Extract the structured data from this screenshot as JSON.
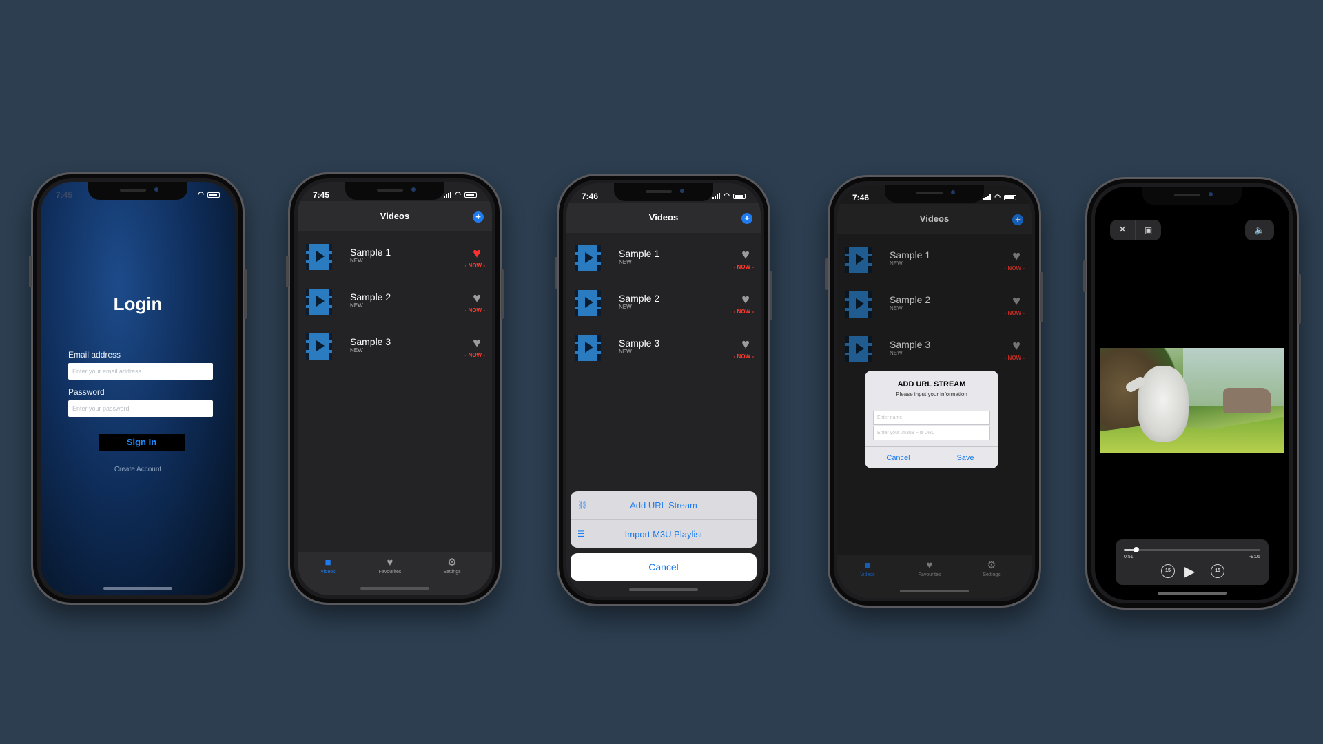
{
  "status": {
    "time_login": "7:45",
    "time_list": "7:45",
    "time_sheet": "7:46",
    "time_alert": "7:46"
  },
  "login": {
    "title": "Login",
    "email_label": "Email address",
    "email_placeholder": "Enter your email address",
    "password_label": "Password",
    "password_placeholder": "Enter your password",
    "signin_label": "Sign In",
    "create_account_label": "Create Account"
  },
  "videos": {
    "nav_title": "Videos",
    "add_icon": "plus-circle-icon",
    "items": [
      {
        "title": "Sample 1",
        "subtitle": "NEW",
        "badge": "- NOW -"
      },
      {
        "title": "Sample 2",
        "subtitle": "NEW",
        "badge": "- NOW -"
      },
      {
        "title": "Sample 3",
        "subtitle": "NEW",
        "badge": "- NOW -"
      }
    ],
    "favourite_colors": {
      "on": "#ff3030",
      "off": "#9b9b9b"
    }
  },
  "tabbar": {
    "videos": "Videos",
    "favourites": "Favourites",
    "settings": "Settings"
  },
  "action_sheet": {
    "add_url_stream": "Add URL Stream",
    "import_playlist": "Import M3U Playlist",
    "cancel": "Cancel"
  },
  "alert": {
    "title": "ADD URL STREAM",
    "message": "Please input your information",
    "name_placeholder": "Enter name",
    "url_placeholder": "Enter your .m3u8 File URL",
    "cancel": "Cancel",
    "save": "Save"
  },
  "player": {
    "elapsed": "0:51",
    "remaining": "-9:05",
    "progress_fraction": 0.09,
    "skip_back": "15",
    "skip_forward": "15"
  },
  "colors": {
    "background": "#2c3e50",
    "accent": "#1e7cf0",
    "alert": "#ff3b30"
  }
}
